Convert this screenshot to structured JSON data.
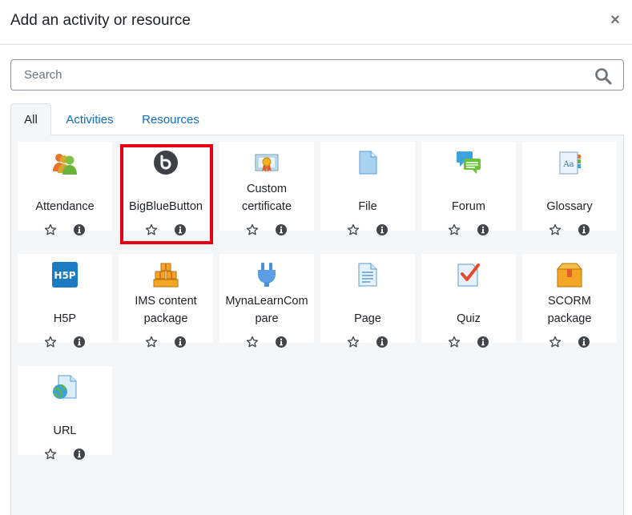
{
  "dialog": {
    "title": "Add an activity or resource",
    "close_symbol": "×"
  },
  "search": {
    "placeholder": "Search",
    "value": ""
  },
  "tabs": [
    {
      "label": "All",
      "active": true
    },
    {
      "label": "Activities",
      "active": false
    },
    {
      "label": "Resources",
      "active": false
    }
  ],
  "modules": [
    {
      "name": "Attendance",
      "lines": [
        "Attendance"
      ],
      "icon": "attendance-icon"
    },
    {
      "name": "BigBlueButton",
      "lines": [
        "BigBlueButton"
      ],
      "icon": "bigbluebutton-icon",
      "highlighted": true
    },
    {
      "name": "Custom certificate",
      "lines": [
        "Custom",
        "certificate"
      ],
      "icon": "certificate-icon"
    },
    {
      "name": "File",
      "lines": [
        "File"
      ],
      "icon": "file-icon"
    },
    {
      "name": "Forum",
      "lines": [
        "Forum"
      ],
      "icon": "forum-icon"
    },
    {
      "name": "Glossary",
      "lines": [
        "Glossary"
      ],
      "icon": "glossary-icon"
    },
    {
      "name": "H5P",
      "lines": [
        "H5P"
      ],
      "icon": "h5p-icon"
    },
    {
      "name": "IMS content package",
      "lines": [
        "IMS content",
        "package"
      ],
      "icon": "ims-package-icon"
    },
    {
      "name": "MynaLearnCompare",
      "lines": [
        "MynaLearnCom",
        "pare"
      ],
      "icon": "plugin-icon"
    },
    {
      "name": "Page",
      "lines": [
        "Page"
      ],
      "icon": "page-icon"
    },
    {
      "name": "Quiz",
      "lines": [
        "Quiz"
      ],
      "icon": "quiz-icon"
    },
    {
      "name": "SCORM package",
      "lines": [
        "SCORM",
        "package"
      ],
      "icon": "scorm-icon"
    },
    {
      "name": "URL",
      "lines": [
        "URL"
      ],
      "icon": "url-icon"
    }
  ],
  "colors": {
    "link": "#0f6cbf",
    "highlight": "#e60012",
    "panel_bg": "#f5f6f7"
  }
}
